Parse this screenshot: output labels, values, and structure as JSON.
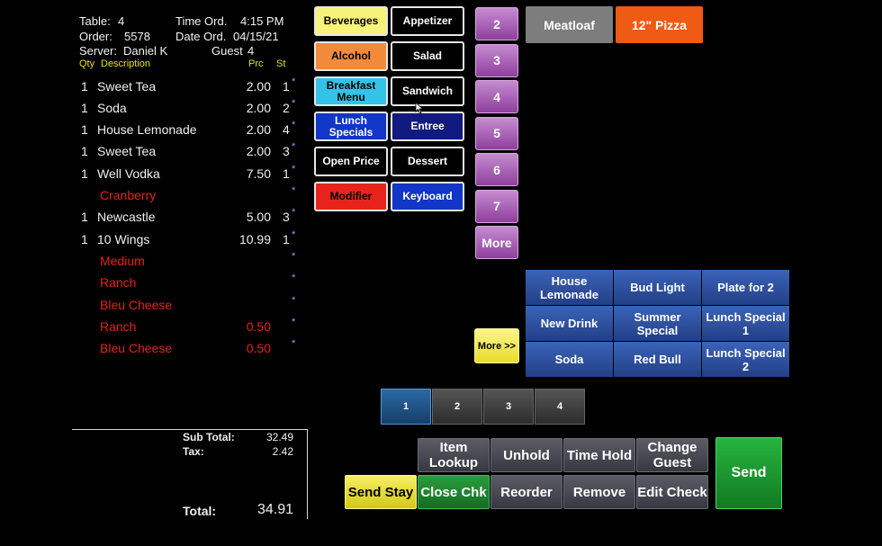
{
  "header": {
    "table_label": "Table:",
    "table_value": "4",
    "time_label": "Time Ord.",
    "time_value": "4:15 PM",
    "order_label": "Order:",
    "order_value": "5578",
    "date_label": "Date Ord.",
    "date_value": "04/15/21",
    "server_label": "Server:",
    "server_value": "Daniel K",
    "guest_label": "Guest",
    "guest_value": "4",
    "col_qty": "Qty",
    "col_desc": "Description",
    "col_prc": "Prc",
    "col_st": "St"
  },
  "order_lines": [
    {
      "qty": "1",
      "desc": "Sweet Tea",
      "prc": "2.00",
      "st": "1",
      "mark": "*",
      "modifier": false
    },
    {
      "qty": "1",
      "desc": "Soda",
      "prc": "2.00",
      "st": "2",
      "mark": "*",
      "modifier": false
    },
    {
      "qty": "1",
      "desc": "House Lemonade",
      "prc": "2.00",
      "st": "4",
      "mark": "*",
      "modifier": false
    },
    {
      "qty": "1",
      "desc": "Sweet Tea",
      "prc": "2.00",
      "st": "3",
      "mark": "*",
      "modifier": false
    },
    {
      "qty": "1",
      "desc": "Well Vodka",
      "prc": "7.50",
      "st": "1",
      "mark": "*",
      "modifier": false
    },
    {
      "qty": "",
      "desc": "Cranberry",
      "prc": "",
      "st": "",
      "mark": "*",
      "modifier": true
    },
    {
      "qty": "1",
      "desc": "Newcastle",
      "prc": "5.00",
      "st": "3",
      "mark": "*",
      "modifier": false
    },
    {
      "qty": "1",
      "desc": "10 Wings",
      "prc": "10.99",
      "st": "1",
      "mark": "*",
      "modifier": false
    },
    {
      "qty": "",
      "desc": "Medium",
      "prc": "",
      "st": "",
      "mark": "*",
      "modifier": true
    },
    {
      "qty": "",
      "desc": "Ranch",
      "prc": "",
      "st": "",
      "mark": "*",
      "modifier": true
    },
    {
      "qty": "",
      "desc": "Bleu Cheese",
      "prc": "",
      "st": "",
      "mark": "*",
      "modifier": true
    },
    {
      "qty": "",
      "desc": "Ranch",
      "prc": "0.50",
      "st": "",
      "mark": "*",
      "modifier": true
    },
    {
      "qty": "",
      "desc": "Bleu Cheese",
      "prc": "0.50",
      "st": "",
      "mark": "*",
      "modifier": true
    }
  ],
  "totals": {
    "subtotal_label": "Sub Total:",
    "subtotal_value": "32.49",
    "tax_label": "Tax:",
    "tax_value": "2.42",
    "total_label": "Total:",
    "total_value": "34.91"
  },
  "categories": [
    {
      "label": "Beverages",
      "bg": "#f7f27a",
      "fg": "#000000"
    },
    {
      "label": "Appetizer",
      "bg": "#000000",
      "fg": "#ffffff"
    },
    {
      "label": "Alcohol",
      "bg": "#f28a3c",
      "fg": "#000000"
    },
    {
      "label": "Salad",
      "bg": "#000000",
      "fg": "#ffffff"
    },
    {
      "label": "Breakfast Menu",
      "bg": "#33c3e6",
      "fg": "#000000"
    },
    {
      "label": "Sandwich",
      "bg": "#000000",
      "fg": "#ffffff"
    },
    {
      "label": "Lunch Specials",
      "bg": "#1136c8",
      "fg": "#ffffff"
    },
    {
      "label": "Entree",
      "bg": "#101a80",
      "fg": "#ffffff"
    },
    {
      "label": "Open Price",
      "bg": "#000000",
      "fg": "#ffffff"
    },
    {
      "label": "Dessert",
      "bg": "#000000",
      "fg": "#ffffff"
    },
    {
      "label": "Modifier",
      "bg": "#e8231c",
      "fg": "#000000"
    },
    {
      "label": "Keyboard",
      "bg": "#1136c8",
      "fg": "#ffffff"
    }
  ],
  "pages": [
    "2",
    "3",
    "4",
    "5",
    "6",
    "7",
    "More"
  ],
  "top_items": [
    {
      "label": "Meatloaf",
      "bg": "#7d7d7d"
    },
    {
      "label": "12\" Pizza",
      "bg": "#ef5a14"
    }
  ],
  "grid_items": [
    "House Lemonade",
    "Bud Light",
    "Plate for 2",
    "New Drink",
    "Summer Special",
    "Lunch Special 1",
    "Soda",
    "Red Bull",
    "Lunch Special 2"
  ],
  "more_yellow": "More >>",
  "seats": [
    "1",
    "2",
    "3",
    "4"
  ],
  "actions": {
    "item_lookup": "Item Lookup",
    "unhold": "Unhold",
    "time_hold": "Time Hold",
    "change_guest": "Change Guest",
    "send_stay": "Send Stay",
    "close_chk": "Close Chk",
    "reorder": "Reorder",
    "remove": "Remove",
    "edit_check": "Edit Check",
    "send": "Send"
  },
  "colors": {
    "send_stay_bg": "#e8dd2c",
    "close_chk_bg": "#1d8a32",
    "send_bg": "#1f9f36"
  }
}
